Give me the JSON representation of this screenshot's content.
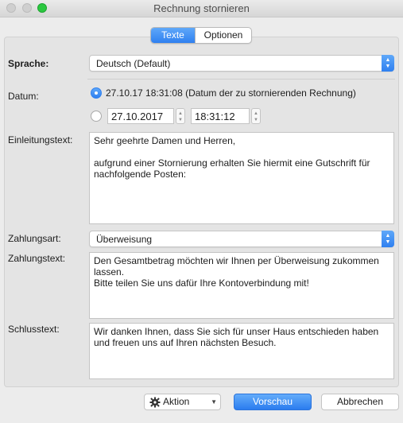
{
  "window": {
    "title": "Rechnung stornieren"
  },
  "tabs": [
    {
      "label": "Texte",
      "active": true
    },
    {
      "label": "Optionen",
      "active": false
    }
  ],
  "sprache": {
    "label": "Sprache:",
    "value": "Deutsch (Default)"
  },
  "datum": {
    "label": "Datum:",
    "option1": "27.10.17 18:31:08 (Datum der zu stornierenden Rechnung)",
    "date_value": "27.10.2017",
    "time_value": "18:31:12"
  },
  "einleitung": {
    "label": "Einleitungstext:",
    "text": "Sehr geehrte Damen und Herren,\n\naufgrund einer Stornierung erhalten Sie hiermit eine Gutschrift für nachfolgende Posten:"
  },
  "zahlungsart": {
    "label": "Zahlungsart:",
    "value": "Überweisung"
  },
  "zahlungstext": {
    "label": "Zahlungstext:",
    "text": "Den Gesamtbetrag möchten wir Ihnen per Überweisung zukommen lassen.\nBitte teilen Sie uns dafür Ihre Kontoverbindung mit!"
  },
  "schluss": {
    "label": "Schlusstext:",
    "text": "Wir danken Ihnen, dass Sie sich für unser Haus entschieden haben und freuen uns auf Ihren nächsten Besuch."
  },
  "buttons": {
    "action": "Aktion",
    "preview": "Vorschau",
    "cancel": "Abbrechen"
  },
  "colors": {
    "accent": "#2f80f0"
  }
}
